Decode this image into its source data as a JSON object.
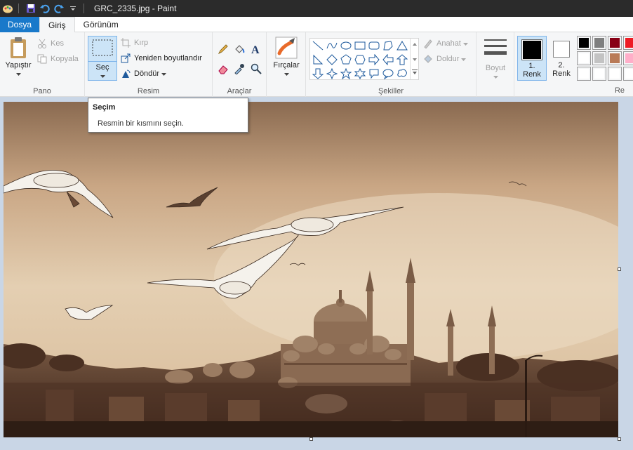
{
  "window": {
    "title": "GRC_2335.jpg - Paint"
  },
  "tabs": [
    {
      "label": "Dosya"
    },
    {
      "label": "Giriş"
    },
    {
      "label": "Görünüm"
    }
  ],
  "ribbon": {
    "pano": {
      "label": "Pano",
      "paste": "Yapıştır",
      "cut": "Kes",
      "copy": "Kopyala"
    },
    "resim": {
      "label": "Resim",
      "select": "Seç",
      "crop": "Kırp",
      "resize": "Yeniden boyutlandır",
      "rotate": "Döndür"
    },
    "araclar": {
      "label": "Araçlar"
    },
    "brushes": {
      "label": "Fırçalar"
    },
    "sekiller": {
      "label": "Şekiller",
      "outline": "Anahat",
      "fill": "Doldur"
    },
    "size": {
      "label": "Boyut"
    },
    "color1": {
      "label_line1": "1.",
      "label_line2": "Renk"
    },
    "color2": {
      "label_line1": "2.",
      "label_line2": "Renk"
    },
    "renkler": {
      "label": "Re"
    }
  },
  "palette": {
    "row1": [
      "#000000",
      "#7f7f7f",
      "#880015",
      "#ed1c24"
    ],
    "row2": [
      "#ffffff",
      "#c3c3c3",
      "#b97a57",
      "#ffaec9"
    ],
    "row3": [
      "#ffffff",
      "#ffffff",
      "#ffffff",
      "#ffffff"
    ],
    "color1": "#000000",
    "color2": "#ffffff"
  },
  "tooltip": {
    "title": "Seçim",
    "body": "Resmin bir kısmını seçin."
  }
}
